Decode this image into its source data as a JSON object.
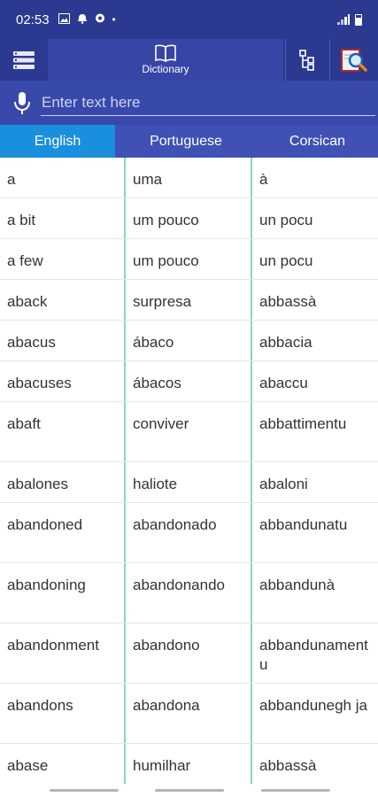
{
  "status": {
    "time": "02:53",
    "dot": "•"
  },
  "appbar": {
    "dictionary_label": "Dictionary"
  },
  "search": {
    "placeholder": "Enter text here",
    "value": ""
  },
  "lang_tabs": [
    {
      "label": "English",
      "active": true
    },
    {
      "label": "Portuguese",
      "active": false
    },
    {
      "label": "Corsican",
      "active": false
    }
  ],
  "rows": [
    [
      "a",
      "uma",
      "à"
    ],
    [
      "a bit",
      "um pouco",
      "un pocu"
    ],
    [
      "a few",
      "um pouco",
      "un pocu"
    ],
    [
      "aback",
      "surpresa",
      "abbassà"
    ],
    [
      "abacus",
      "ábaco",
      "abbacia"
    ],
    [
      "abacuses",
      "ábacos",
      "abaccu"
    ],
    [
      "abaft",
      "conviver",
      "abbattimentu"
    ],
    [
      "abalones",
      "haliote",
      "abaloni"
    ],
    [
      "abandoned",
      "abandonado",
      "abbandunatu"
    ],
    [
      "abandoning",
      "abandonando",
      "abbandunà"
    ],
    [
      "abandonment",
      "abandono",
      "abbandunamentu"
    ],
    [
      "abandons",
      "abandona",
      "abbandunegh ja"
    ],
    [
      "abase",
      "humilhar",
      "abbassà"
    ]
  ],
  "colors": {
    "primary": "#2b3990",
    "active_tab": "#1a8fdd",
    "divider": "#8ed3c0"
  }
}
